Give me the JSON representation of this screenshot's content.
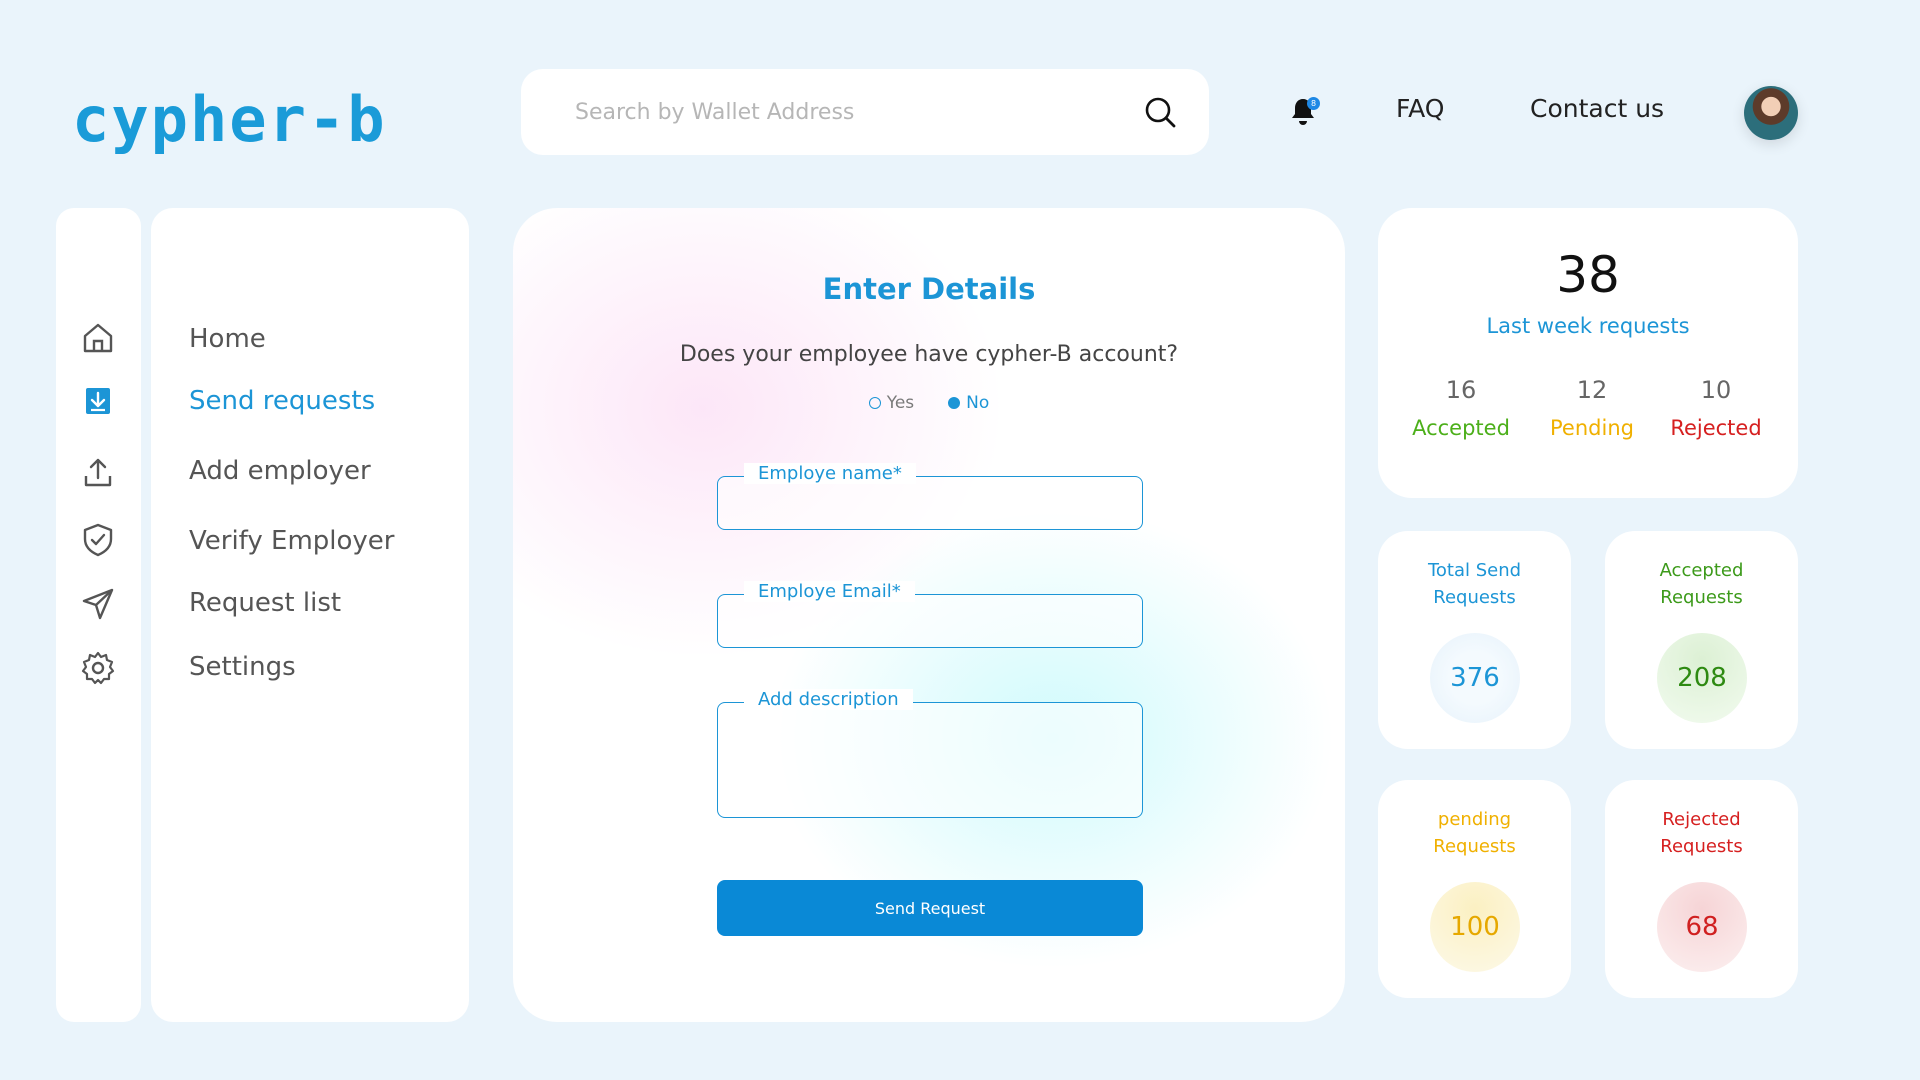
{
  "header": {
    "logo_text": "cypher-b",
    "search_placeholder": "Search by Wallet Address",
    "notification_count": "8",
    "faq_label": "FAQ",
    "contact_label": "Contact us"
  },
  "sidebar": {
    "items": [
      {
        "label": "Home",
        "icon": "home-icon",
        "active": false
      },
      {
        "label": "Send requests",
        "icon": "download-icon",
        "active": true
      },
      {
        "label": "Add employer",
        "icon": "upload-icon",
        "active": false
      },
      {
        "label": "Verify Employer",
        "icon": "shield-check-icon",
        "active": false
      },
      {
        "label": "Request list",
        "icon": "send-icon",
        "active": false
      },
      {
        "label": "Settings",
        "icon": "gear-icon",
        "active": false
      }
    ]
  },
  "form": {
    "title": "Enter Details",
    "question": "Does your employee have cypher-B account?",
    "radio_yes": "Yes",
    "radio_no": "No",
    "selected": "No",
    "name_label": "Employe name*",
    "email_label": "Employe Email*",
    "description_label": "Add description",
    "submit_label": "Send Request"
  },
  "week_summary": {
    "count": "38",
    "label": "Last week requests",
    "accepted_count": "16",
    "accepted_label": "Accepted",
    "pending_count": "12",
    "pending_label": "Pending",
    "rejected_count": "10",
    "rejected_label": "Rejected"
  },
  "stats": {
    "total": {
      "title": "Total Send\nRequests",
      "value": "376"
    },
    "accepted": {
      "title": "Accepted\nRequests",
      "value": "208"
    },
    "pending": {
      "title": "pending\nRequests",
      "value": "100"
    },
    "rejected": {
      "title": "Rejected\nRequests",
      "value": "68"
    }
  },
  "colors": {
    "accent": "#1c95d6",
    "accepted": "#4caf1a",
    "pending": "#f0b000",
    "rejected": "#d62020"
  }
}
